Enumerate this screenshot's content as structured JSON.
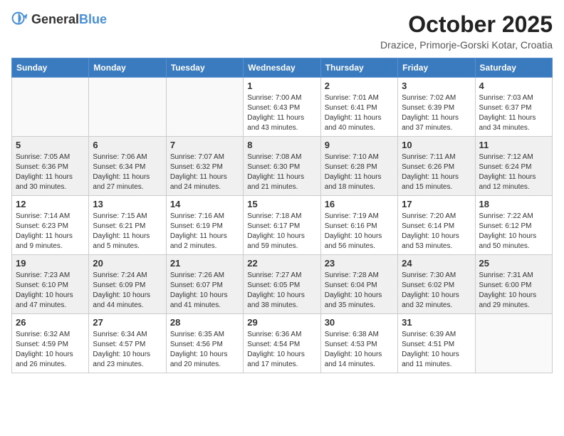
{
  "header": {
    "logo_general": "General",
    "logo_blue": "Blue",
    "title": "October 2025",
    "location": "Drazice, Primorje-Gorski Kotar, Croatia"
  },
  "weekdays": [
    "Sunday",
    "Monday",
    "Tuesday",
    "Wednesday",
    "Thursday",
    "Friday",
    "Saturday"
  ],
  "weeks": [
    [
      {
        "day": "",
        "info": ""
      },
      {
        "day": "",
        "info": ""
      },
      {
        "day": "",
        "info": ""
      },
      {
        "day": "1",
        "info": "Sunrise: 7:00 AM\nSunset: 6:43 PM\nDaylight: 11 hours\nand 43 minutes."
      },
      {
        "day": "2",
        "info": "Sunrise: 7:01 AM\nSunset: 6:41 PM\nDaylight: 11 hours\nand 40 minutes."
      },
      {
        "day": "3",
        "info": "Sunrise: 7:02 AM\nSunset: 6:39 PM\nDaylight: 11 hours\nand 37 minutes."
      },
      {
        "day": "4",
        "info": "Sunrise: 7:03 AM\nSunset: 6:37 PM\nDaylight: 11 hours\nand 34 minutes."
      }
    ],
    [
      {
        "day": "5",
        "info": "Sunrise: 7:05 AM\nSunset: 6:36 PM\nDaylight: 11 hours\nand 30 minutes."
      },
      {
        "day": "6",
        "info": "Sunrise: 7:06 AM\nSunset: 6:34 PM\nDaylight: 11 hours\nand 27 minutes."
      },
      {
        "day": "7",
        "info": "Sunrise: 7:07 AM\nSunset: 6:32 PM\nDaylight: 11 hours\nand 24 minutes."
      },
      {
        "day": "8",
        "info": "Sunrise: 7:08 AM\nSunset: 6:30 PM\nDaylight: 11 hours\nand 21 minutes."
      },
      {
        "day": "9",
        "info": "Sunrise: 7:10 AM\nSunset: 6:28 PM\nDaylight: 11 hours\nand 18 minutes."
      },
      {
        "day": "10",
        "info": "Sunrise: 7:11 AM\nSunset: 6:26 PM\nDaylight: 11 hours\nand 15 minutes."
      },
      {
        "day": "11",
        "info": "Sunrise: 7:12 AM\nSunset: 6:24 PM\nDaylight: 11 hours\nand 12 minutes."
      }
    ],
    [
      {
        "day": "12",
        "info": "Sunrise: 7:14 AM\nSunset: 6:23 PM\nDaylight: 11 hours\nand 9 minutes."
      },
      {
        "day": "13",
        "info": "Sunrise: 7:15 AM\nSunset: 6:21 PM\nDaylight: 11 hours\nand 5 minutes."
      },
      {
        "day": "14",
        "info": "Sunrise: 7:16 AM\nSunset: 6:19 PM\nDaylight: 11 hours\nand 2 minutes."
      },
      {
        "day": "15",
        "info": "Sunrise: 7:18 AM\nSunset: 6:17 PM\nDaylight: 10 hours\nand 59 minutes."
      },
      {
        "day": "16",
        "info": "Sunrise: 7:19 AM\nSunset: 6:16 PM\nDaylight: 10 hours\nand 56 minutes."
      },
      {
        "day": "17",
        "info": "Sunrise: 7:20 AM\nSunset: 6:14 PM\nDaylight: 10 hours\nand 53 minutes."
      },
      {
        "day": "18",
        "info": "Sunrise: 7:22 AM\nSunset: 6:12 PM\nDaylight: 10 hours\nand 50 minutes."
      }
    ],
    [
      {
        "day": "19",
        "info": "Sunrise: 7:23 AM\nSunset: 6:10 PM\nDaylight: 10 hours\nand 47 minutes."
      },
      {
        "day": "20",
        "info": "Sunrise: 7:24 AM\nSunset: 6:09 PM\nDaylight: 10 hours\nand 44 minutes."
      },
      {
        "day": "21",
        "info": "Sunrise: 7:26 AM\nSunset: 6:07 PM\nDaylight: 10 hours\nand 41 minutes."
      },
      {
        "day": "22",
        "info": "Sunrise: 7:27 AM\nSunset: 6:05 PM\nDaylight: 10 hours\nand 38 minutes."
      },
      {
        "day": "23",
        "info": "Sunrise: 7:28 AM\nSunset: 6:04 PM\nDaylight: 10 hours\nand 35 minutes."
      },
      {
        "day": "24",
        "info": "Sunrise: 7:30 AM\nSunset: 6:02 PM\nDaylight: 10 hours\nand 32 minutes."
      },
      {
        "day": "25",
        "info": "Sunrise: 7:31 AM\nSunset: 6:00 PM\nDaylight: 10 hours\nand 29 minutes."
      }
    ],
    [
      {
        "day": "26",
        "info": "Sunrise: 6:32 AM\nSunset: 4:59 PM\nDaylight: 10 hours\nand 26 minutes."
      },
      {
        "day": "27",
        "info": "Sunrise: 6:34 AM\nSunset: 4:57 PM\nDaylight: 10 hours\nand 23 minutes."
      },
      {
        "day": "28",
        "info": "Sunrise: 6:35 AM\nSunset: 4:56 PM\nDaylight: 10 hours\nand 20 minutes."
      },
      {
        "day": "29",
        "info": "Sunrise: 6:36 AM\nSunset: 4:54 PM\nDaylight: 10 hours\nand 17 minutes."
      },
      {
        "day": "30",
        "info": "Sunrise: 6:38 AM\nSunset: 4:53 PM\nDaylight: 10 hours\nand 14 minutes."
      },
      {
        "day": "31",
        "info": "Sunrise: 6:39 AM\nSunset: 4:51 PM\nDaylight: 10 hours\nand 11 minutes."
      },
      {
        "day": "",
        "info": ""
      }
    ]
  ]
}
